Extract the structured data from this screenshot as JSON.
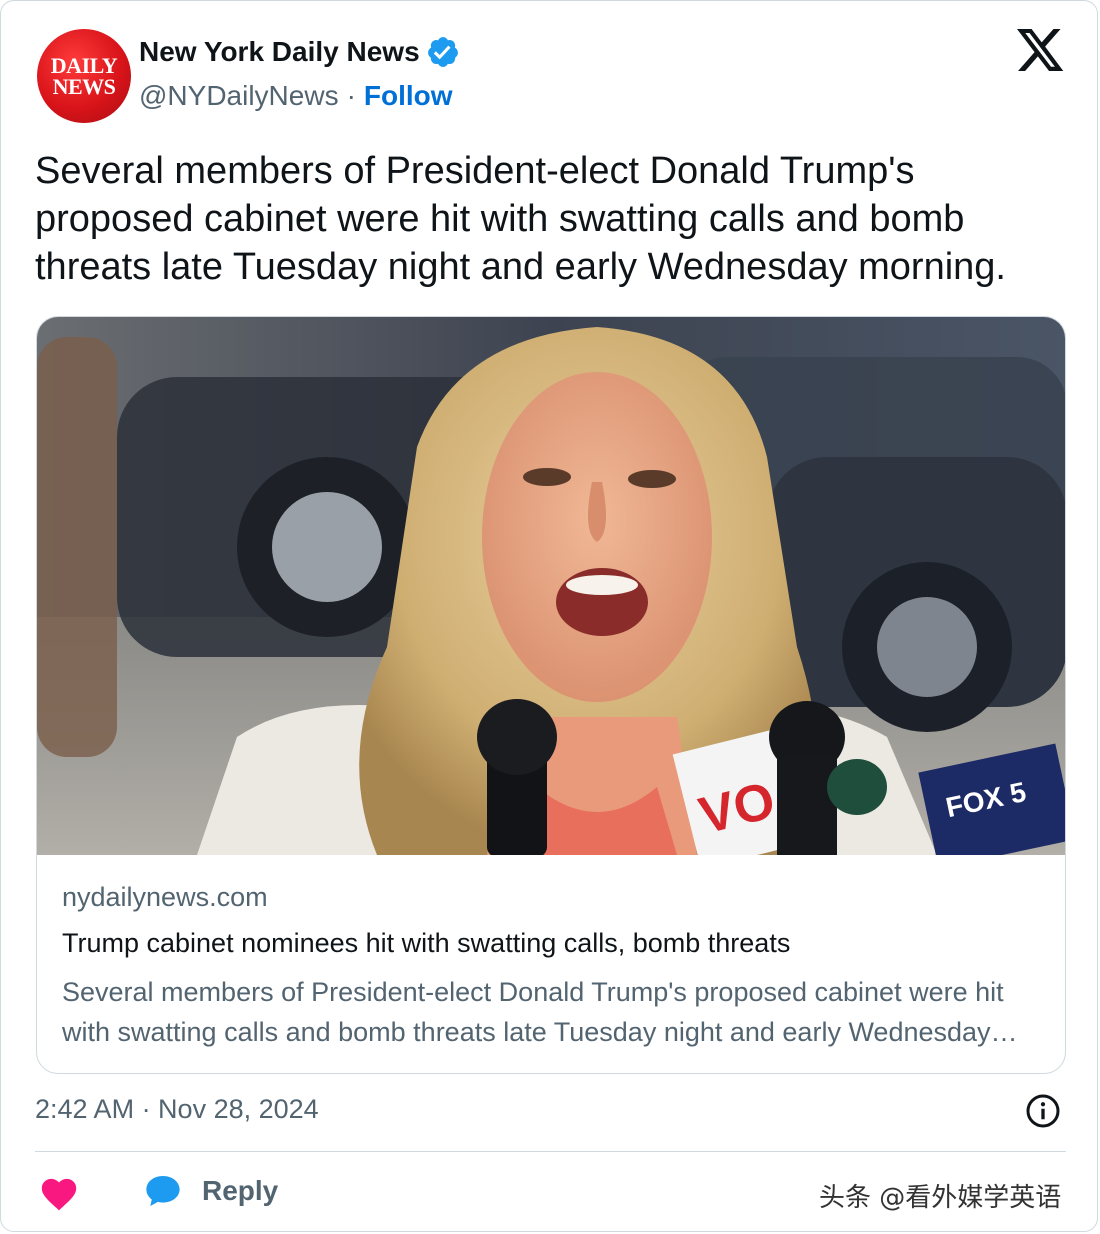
{
  "account": {
    "display_name": "New York Daily News",
    "handle": "@NYDailyNews",
    "separator": "·",
    "follow_label": "Follow",
    "avatar_logo_line1": "DAILY",
    "avatar_logo_line2": "NEWS"
  },
  "tweet": {
    "text": "Several members of President-elect Donald Trump's proposed cabinet were hit with swatting calls and bomb threats late Tuesday night and early Wednesday morning."
  },
  "link_card": {
    "domain": "nydailynews.com",
    "title": "Trump cabinet nominees hit with swatting calls, bomb threats",
    "description": "Several members of President-elect Donald Trump's proposed cabinet were hit with swatting calls and bomb threats late Tuesday night and early Wednesday morning.",
    "photo_mic_labels": [
      "VOA",
      "FOX 5"
    ]
  },
  "footer": {
    "timestamp": "2:42 AM · Nov 28, 2024",
    "reply_label": "Reply"
  },
  "watermark": "头条 @看外媒学英语",
  "colors": {
    "link_blue": "#006fd6",
    "verified_blue": "#1d9bf0",
    "heart_pink": "#f91880",
    "muted_text": "#536471",
    "border": "#cfd9de"
  },
  "icons": [
    "verified-badge-icon",
    "x-logo-icon",
    "info-icon",
    "heart-icon",
    "reply-bubble-icon"
  ]
}
